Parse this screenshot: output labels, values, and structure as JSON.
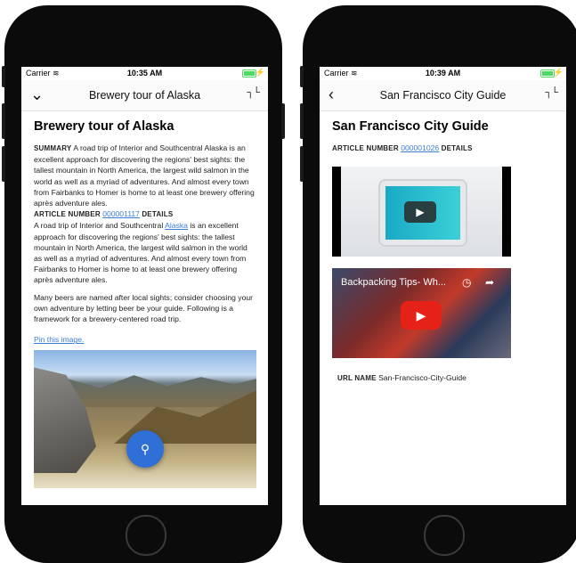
{
  "left_phone": {
    "status": {
      "carrier": "Carrier",
      "time": "10:35 AM"
    },
    "nav": {
      "back_icon": "chevron-down-icon",
      "title": "Brewery tour of Alaska",
      "collapse_icon": "collapse-icon"
    },
    "article": {
      "heading": "Brewery tour of Alaska",
      "summary_label": "SUMMARY",
      "summary_text": "A road trip of Interior and Southcentral Alaska is an excellent approach for discovering the regions' best sights: the tallest mountain in North America, the largest wild salmon in the world as well as a myriad of adventures. And almost every town from Fairbanks to Homer is home to at least one brewery offering après adventure ales.",
      "article_number_label": "ARTICLE NUMBER",
      "article_number": "000001117",
      "details_label": "DETAILS",
      "details_prefix": "A road trip of Interior and Southcentral",
      "details_link": "Alaska",
      "details_suffix": "is an excellent approach for discovering the regions' best sights: the tallest mountain in North America, the largest wild salmon in the world as well as a myriad of adventures. And almost every town from Fairbanks to Homer is home to at least one brewery offering après adventure ales.",
      "para2": "Many beers are named after local sights; consider choosing your own adventure by letting beer be your guide. Following is a framework for a brewery-centered road trip.",
      "pin_link": "Pin this image."
    },
    "fab_icon": "search-icon"
  },
  "right_phone": {
    "status": {
      "carrier": "Carrier",
      "time": "10:39 AM"
    },
    "nav": {
      "back_icon": "chevron-left-icon",
      "title": "San Francisco City Guide",
      "collapse_icon": "collapse-icon"
    },
    "article": {
      "heading": "San Francisco City Guide",
      "article_number_label": "ARTICLE NUMBER",
      "article_number": "000001026",
      "details_label": "DETAILS",
      "video2_title": "Backpacking Tips- Wh...",
      "url_name_label": "URL NAME",
      "url_name": "San-Francisco-City-Guide"
    }
  }
}
